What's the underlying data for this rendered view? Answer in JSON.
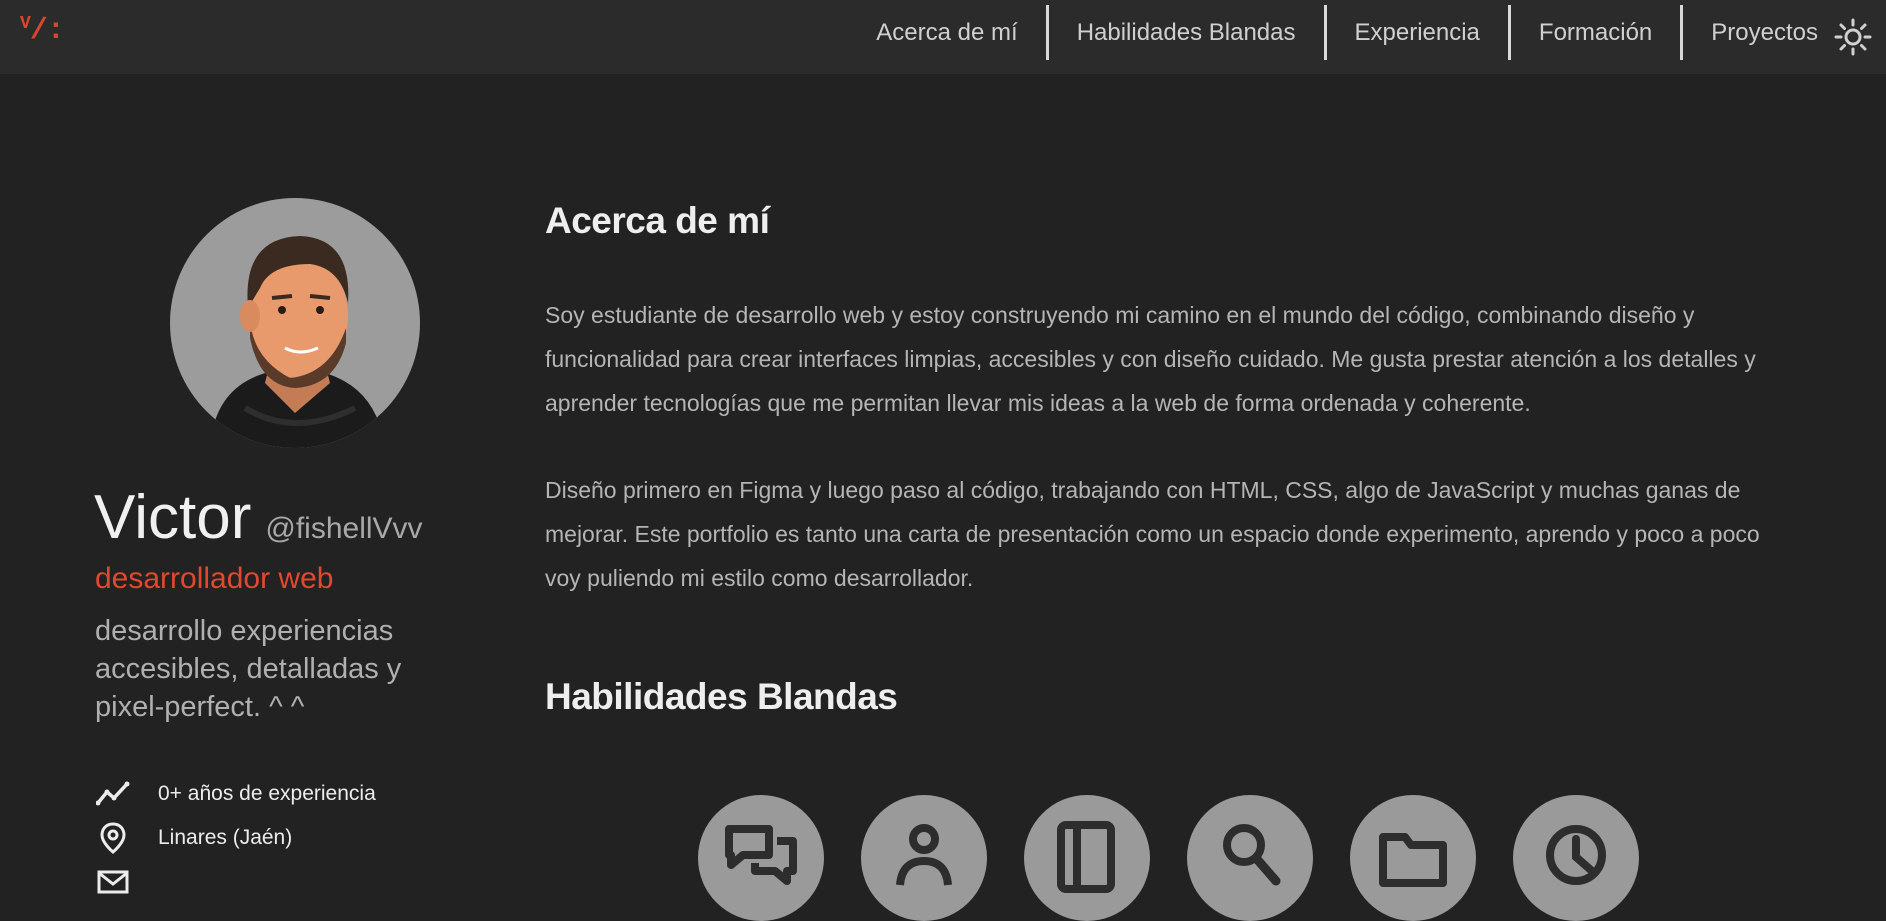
{
  "header": {
    "logo": {
      "main": "/:",
      "sup": "V"
    },
    "nav": [
      {
        "label": "Acerca de mí"
      },
      {
        "label": "Habilidades Blandas"
      },
      {
        "label": "Experiencia"
      },
      {
        "label": "Formación"
      },
      {
        "label": "Proyectos"
      }
    ],
    "theme_icon": "sun-icon"
  },
  "profile": {
    "name": "Victor",
    "handle": "@fishellVvv",
    "role": "desarrollador web",
    "tagline": "desarrollo experiencias accesibles, detalladas y pixel-perfect. ^ ^",
    "facts": [
      {
        "icon": "trend-line-icon",
        "text": "0+ años de experiencia"
      },
      {
        "icon": "location-pin-icon",
        "text": "Linares (Jaén)"
      },
      {
        "icon": "mail-icon",
        "text": ""
      }
    ]
  },
  "about": {
    "title": "Acerca de mí",
    "paragraphs": [
      "Soy estudiante de desarrollo web y estoy construyendo mi camino en el mundo del código, combinando diseño y funcionalidad para crear interfaces limpias, accesibles y con diseño cuidado. Me gusta prestar atención a los detalles y aprender tecnologías que me permitan llevar mis ideas a la web de forma ordenada y coherente.",
      "Diseño primero en Figma y luego paso al código, trabajando con HTML, CSS, algo de JavaScript y muchas ganas de mejorar. Este portfolio es tanto una carta de presentación como un espacio donde experimento, aprendo y poco a poco voy puliendo mi estilo como desarrollador."
    ]
  },
  "soft_skills": {
    "title": "Habilidades Blandas",
    "icons": [
      "chat-icon",
      "person-icon",
      "book-icon",
      "search-icon",
      "folder-icon",
      "clock-icon"
    ]
  },
  "colors": {
    "accent": "#e0492d",
    "background": "#222222",
    "header": "#2b2b2b"
  }
}
